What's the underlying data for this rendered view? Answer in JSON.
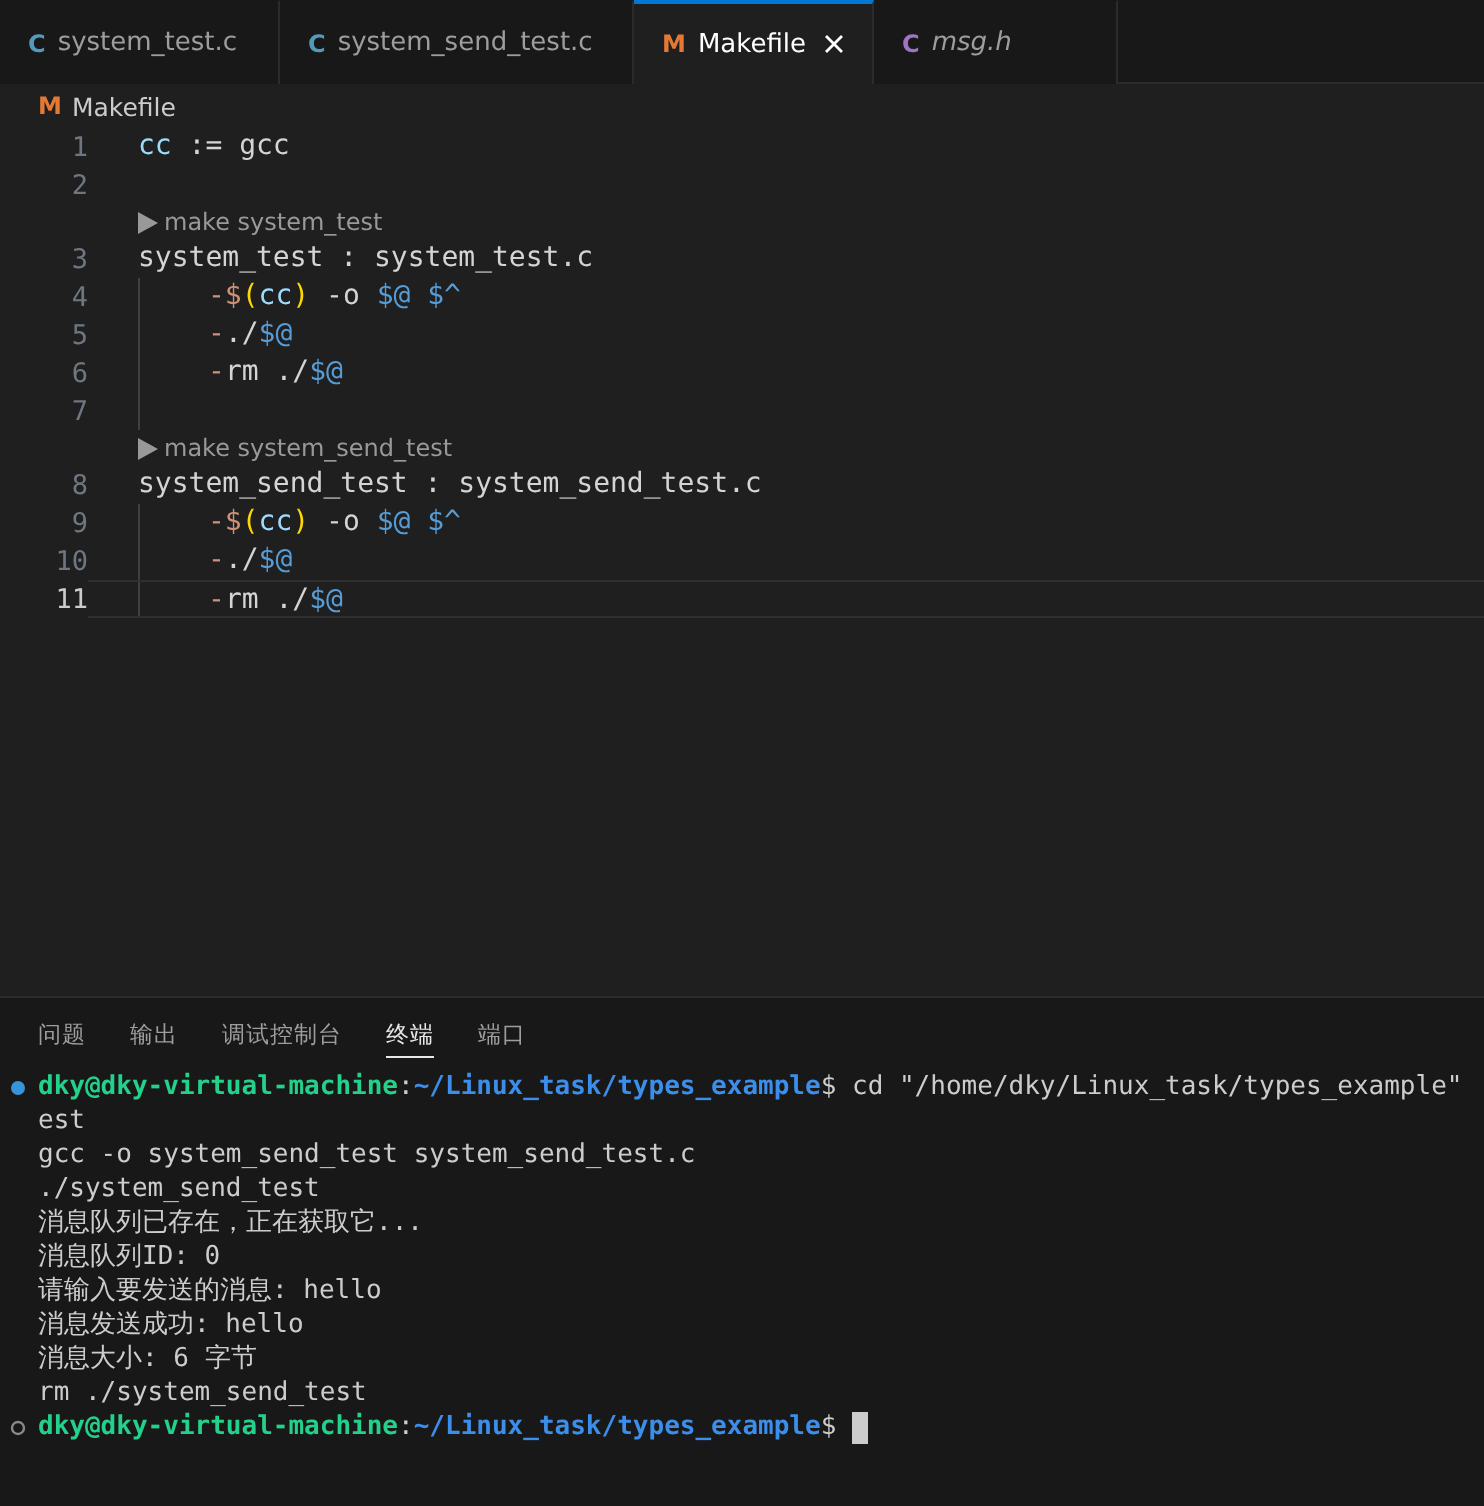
{
  "tabs": [
    {
      "kind": "c-source",
      "icon": "C",
      "label": "system_test.c",
      "selected": false,
      "preview": false
    },
    {
      "kind": "c-source",
      "icon": "C",
      "label": "system_send_test.c",
      "selected": false,
      "preview": false
    },
    {
      "kind": "makefile",
      "icon": "M",
      "label": "Makefile",
      "selected": true,
      "preview": false
    },
    {
      "kind": "c-header",
      "icon": "C",
      "label": "msg.h",
      "selected": false,
      "preview": true
    }
  ],
  "breadcrumb": {
    "kind": "makefile",
    "icon": "M",
    "label": "Makefile"
  },
  "editor": {
    "lines": [
      {
        "kind": "code",
        "number": "1",
        "indent": false,
        "current": false,
        "segments": [
          {
            "kind": "variable",
            "text": "cc"
          },
          {
            "kind": "plain",
            "text": " := gcc"
          }
        ]
      },
      {
        "kind": "code",
        "number": "2",
        "indent": false,
        "current": false
      },
      {
        "kind": "lens",
        "text": "make system_test"
      },
      {
        "kind": "code",
        "number": "3",
        "indent": false,
        "current": false,
        "segments": [
          {
            "kind": "plain",
            "text": "system_test : system_test.c"
          }
        ]
      },
      {
        "kind": "code",
        "number": "4",
        "indent": true,
        "current": false,
        "segments": [
          {
            "kind": "operator",
            "text": "-$"
          },
          {
            "kind": "bracket",
            "text": "("
          },
          {
            "kind": "variable",
            "text": "cc"
          },
          {
            "kind": "bracket",
            "text": ")"
          },
          {
            "kind": "plain",
            "text": " -o "
          },
          {
            "kind": "automatic",
            "text": "$@ $^"
          }
        ]
      },
      {
        "kind": "code",
        "number": "5",
        "indent": true,
        "current": false,
        "segments": [
          {
            "kind": "operator",
            "text": "-"
          },
          {
            "kind": "plain",
            "text": "./"
          },
          {
            "kind": "automatic",
            "text": "$@"
          }
        ]
      },
      {
        "kind": "code",
        "number": "6",
        "indent": true,
        "current": false,
        "segments": [
          {
            "kind": "operator",
            "text": "-"
          },
          {
            "kind": "plain",
            "text": "rm ./"
          },
          {
            "kind": "automatic",
            "text": "$@"
          }
        ]
      },
      {
        "kind": "code",
        "number": "7",
        "indent": true,
        "current": false
      },
      {
        "kind": "lens",
        "text": "make system_send_test"
      },
      {
        "kind": "code",
        "number": "8",
        "indent": false,
        "current": false,
        "segments": [
          {
            "kind": "plain",
            "text": "system_send_test : system_send_test.c"
          }
        ]
      },
      {
        "kind": "code",
        "number": "9",
        "indent": true,
        "current": false,
        "segments": [
          {
            "kind": "operator",
            "text": "-$"
          },
          {
            "kind": "bracket",
            "text": "("
          },
          {
            "kind": "variable",
            "text": "cc"
          },
          {
            "kind": "bracket",
            "text": ")"
          },
          {
            "kind": "plain",
            "text": " -o "
          },
          {
            "kind": "automatic",
            "text": "$@ $^"
          }
        ]
      },
      {
        "kind": "code",
        "number": "10",
        "indent": true,
        "current": false,
        "segments": [
          {
            "kind": "operator",
            "text": "-"
          },
          {
            "kind": "plain",
            "text": "./"
          },
          {
            "kind": "automatic",
            "text": "$@"
          }
        ]
      },
      {
        "kind": "code",
        "number": "11",
        "indent": true,
        "current": true,
        "segments": [
          {
            "kind": "operator",
            "text": "-"
          },
          {
            "kind": "plain",
            "text": "rm ./"
          },
          {
            "kind": "automatic",
            "text": "$@"
          }
        ]
      }
    ]
  },
  "panel": {
    "tabs": [
      {
        "label": "问题",
        "selected": false
      },
      {
        "label": "输出",
        "selected": false
      },
      {
        "label": "调试控制台",
        "selected": false
      },
      {
        "label": "终端",
        "selected": true
      },
      {
        "label": "端口",
        "selected": false
      }
    ],
    "terminal": [
      {
        "kind": "prompt",
        "finished": true,
        "user": "dky@dky-virtual-machine",
        "separator": ":",
        "path": "~/Linux_task/types_example",
        "dollar": "$",
        "command": " cd \"/home/dky/Linux_task/types_example\"",
        "cursor": false
      },
      {
        "kind": "output",
        "text": "est"
      },
      {
        "kind": "output",
        "text": "gcc -o system_send_test system_send_test.c"
      },
      {
        "kind": "output",
        "text": "./system_send_test"
      },
      {
        "kind": "output",
        "text": "消息队列已存在，正在获取它..."
      },
      {
        "kind": "output",
        "text": "消息队列ID: 0"
      },
      {
        "kind": "output",
        "text": "请输入要发送的消息: hello"
      },
      {
        "kind": "output",
        "text": "消息发送成功: hello"
      },
      {
        "kind": "output",
        "text": "消息大小: 6 字节"
      },
      {
        "kind": "output",
        "text": "rm ./system_send_test"
      },
      {
        "kind": "prompt",
        "finished": false,
        "user": "dky@dky-virtual-machine",
        "separator": ":",
        "path": "~/Linux_task/types_example",
        "dollar": "$",
        "cursor": true
      }
    ]
  }
}
